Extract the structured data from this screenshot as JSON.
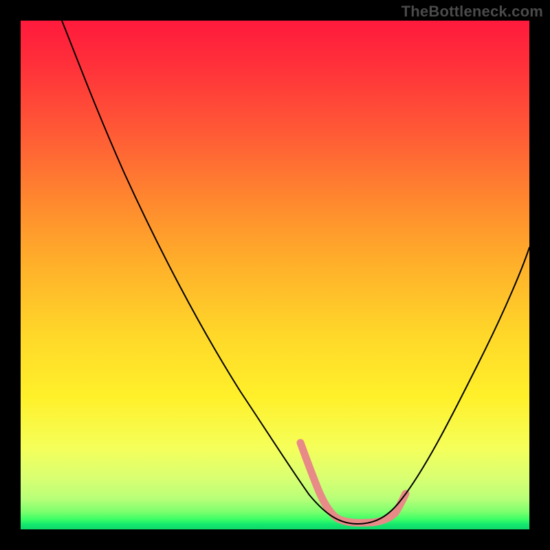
{
  "watermark": "TheBottleneck.com",
  "colors": {
    "frame": "#000000",
    "watermark_text": "#4a4a4a",
    "curve": "#000000",
    "highlight": "#e88a87"
  },
  "chart_data": {
    "type": "line",
    "title": "",
    "xlabel": "",
    "ylabel": "",
    "xlim": [
      0,
      100
    ],
    "ylim": [
      0,
      100
    ],
    "grid": false,
    "background_gradient": {
      "direction": "vertical",
      "stops": [
        {
          "pos": 0,
          "color": "#ff1a3c"
        },
        {
          "pos": 22,
          "color": "#ff5a36"
        },
        {
          "pos": 48,
          "color": "#ffb02a"
        },
        {
          "pos": 74,
          "color": "#fff02a"
        },
        {
          "pos": 94,
          "color": "#b8ff78"
        },
        {
          "pos": 100,
          "color": "#0fd66b"
        }
      ]
    },
    "series": [
      {
        "name": "bottleneck-curve",
        "x": [
          8,
          12,
          18,
          25,
          32,
          40,
          48,
          55,
          58,
          60,
          62,
          65,
          68,
          70,
          72,
          74,
          78,
          84,
          90,
          96,
          100
        ],
        "y": [
          100,
          92,
          82,
          70,
          58,
          44,
          30,
          17,
          11,
          7,
          4,
          2,
          1.5,
          1.5,
          2,
          3,
          8,
          20,
          34,
          48,
          58
        ]
      }
    ],
    "highlighted_range": {
      "series": "bottleneck-curve",
      "x_start": 55,
      "x_end": 74,
      "note": "flat bottom region drawn with thick pink stroke"
    }
  }
}
